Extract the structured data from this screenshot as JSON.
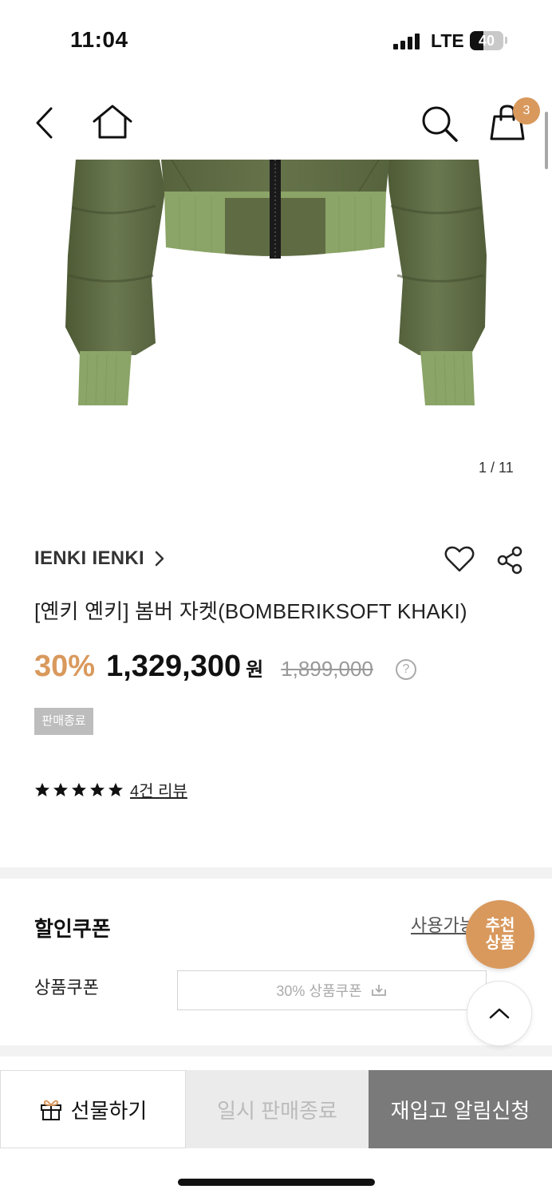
{
  "status_bar": {
    "time": "11:04",
    "network": "LTE",
    "battery": "40",
    "battery_level": 0.4
  },
  "nav": {
    "back_icon": "chevron-left-icon",
    "home_icon": "home-icon",
    "search_icon": "search-icon",
    "cart_icon": "shopping-bag-icon",
    "cart_count": "3"
  },
  "gallery": {
    "counter": "1 / 11"
  },
  "product": {
    "brand": "IENKI IENKI",
    "name": "[옌키 옌키] 봄버 자켓(BOMBERIKSOFT KHAKI)",
    "discount": "30%",
    "price": "1,329,300",
    "currency": "원",
    "original_price": "1,899,000",
    "help": "?",
    "status_badge": "판매종료",
    "rating": 5,
    "review_link": "4건 리뷰"
  },
  "coupon": {
    "title": "할인쿠폰",
    "available_link": "사용가능",
    "label": "상품쿠폰",
    "coupon_button": "30% 상품쿠폰"
  },
  "floating": {
    "recommend_line1": "추천",
    "recommend_line2": "상품"
  },
  "bottom_bar": {
    "gift": "선물하기",
    "soldout": "일시 판매종료",
    "restock": "재입고 알림신청"
  },
  "colors": {
    "accent": "#d9995d",
    "jacket": "#5b6840",
    "rib": "#8fa66c",
    "restock_bg": "#7a7a7a"
  }
}
